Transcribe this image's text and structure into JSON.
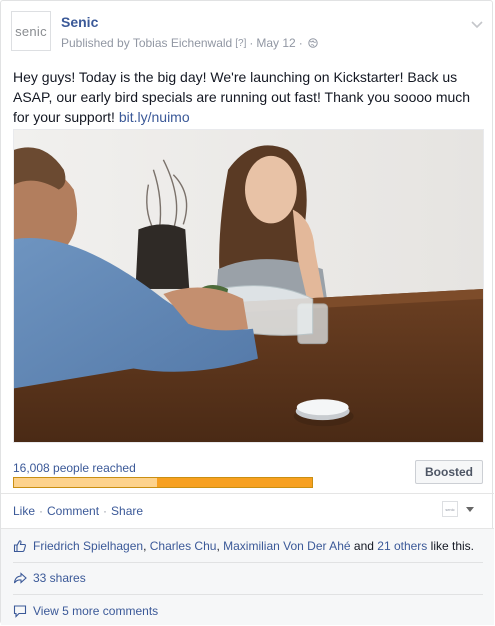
{
  "post": {
    "page_name": "Senic",
    "avatar_text": "senic",
    "published_by": "Published by Tobias Eichenwald",
    "help_mark": "[?]",
    "separator": "·",
    "date": "May 12",
    "text_before_link": "Hey guys! Today is the big day! We're launching on Kickstarter! Back us ASAP, our early bird specials are running out fast! Thank you soooo much for your support! ",
    "link_text": "bit.ly/nuimo"
  },
  "insights": {
    "reach_label": "16,008 people reached",
    "organic_fraction": 0.48,
    "paid_fraction": 0.52,
    "boosted_label": "Boosted"
  },
  "actions": {
    "like": "Like",
    "comment": "Comment",
    "share": "Share",
    "dot": "·",
    "actor_avatar_text": "senic"
  },
  "ufi": {
    "likers": [
      "Friedrich Spielhagen",
      "Charles Chu",
      "Maximilian Von Der Ahé"
    ],
    "comma": ",",
    "and": "and",
    "others": "21 others",
    "like_suffix": "like this.",
    "shares": "33 shares",
    "view_comments": "View 5 more comments"
  },
  "colors": {
    "link": "#3b5998",
    "organic_bar": "#fdd28c",
    "paid_bar": "#f7a020"
  }
}
